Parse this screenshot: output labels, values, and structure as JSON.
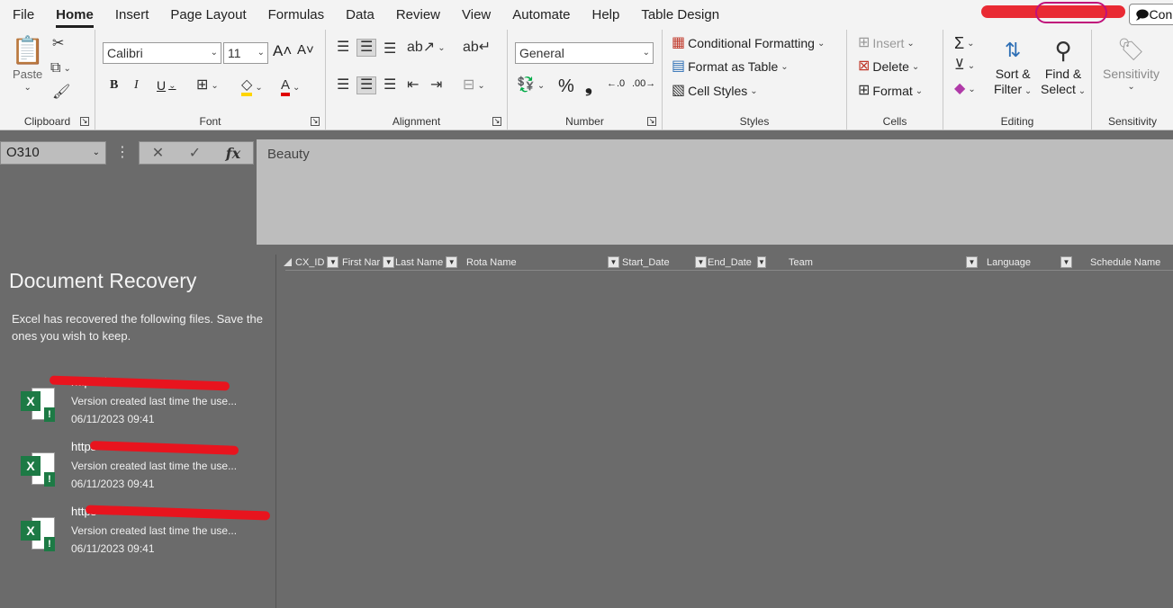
{
  "tabs": [
    "File",
    "Home",
    "Insert",
    "Page Layout",
    "Formulas",
    "Data",
    "Review",
    "View",
    "Automate",
    "Help",
    "Table Design"
  ],
  "active_tab": "Home",
  "comments_label": "Con",
  "ribbon": {
    "clipboard": {
      "label": "Clipboard",
      "paste": "Paste"
    },
    "font": {
      "label": "Font",
      "font_name": "Calibri",
      "font_size": "11"
    },
    "alignment": {
      "label": "Alignment"
    },
    "number": {
      "label": "Number",
      "format": "General"
    },
    "styles": {
      "label": "Styles",
      "conditional": "Conditional Formatting",
      "format_table": "Format as Table",
      "cell_styles": "Cell Styles"
    },
    "cells": {
      "label": "Cells",
      "insert": "Insert",
      "delete": "Delete",
      "format": "Format"
    },
    "editing": {
      "label": "Editing",
      "sort": "Sort &",
      "filter": "Filter",
      "find": "Find &",
      "select": "Select"
    },
    "sensitivity": {
      "label": "Sensitivity",
      "button": "Sensitivity"
    }
  },
  "formula_bar": {
    "name_box": "O310",
    "content": "Beauty"
  },
  "columns": [
    "CX_ID",
    "First Nar",
    "Last Name",
    "Rota Name",
    "Start_Date",
    "End_Date",
    "Team",
    "Language",
    "Schedule Name"
  ],
  "recovery": {
    "title": "Document Recovery",
    "description": "Excel has recovered the following files.  Save the ones you wish to keep.",
    "items": [
      {
        "url": "https://",
        "version": "Version created last time the use...",
        "date": "06/11/2023 09:41"
      },
      {
        "url": "https",
        "version": "Version created last time the use...",
        "date": "06/11/2023 09:41"
      },
      {
        "url": "https",
        "version": "Version created last time the use...",
        "date": "06/11/2023 09:41"
      }
    ]
  },
  "colors": {
    "ribbon_bg": "#f3f3f3",
    "sheet_bg": "#6b6b6b",
    "excel_green": "#1d7a45",
    "redaction": "#e8141e"
  }
}
